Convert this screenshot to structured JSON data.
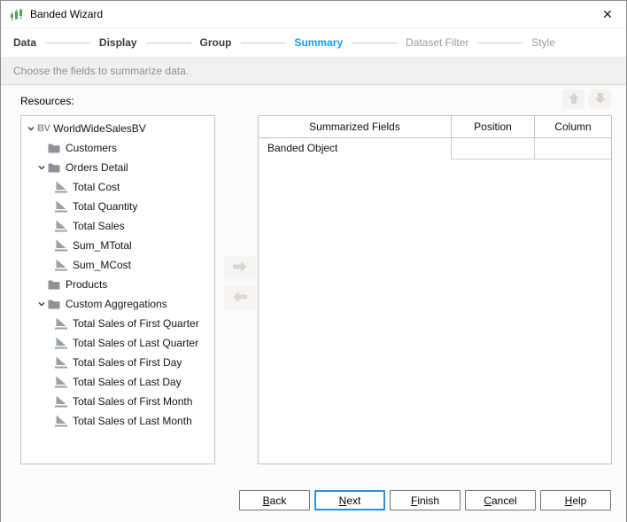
{
  "window": {
    "title": "Banded Wizard",
    "close_glyph": "✕"
  },
  "steps": {
    "items": [
      {
        "label": "Data",
        "state": "visited"
      },
      {
        "label": "Display",
        "state": "visited"
      },
      {
        "label": "Group",
        "state": "visited"
      },
      {
        "label": "Summary",
        "state": "current"
      },
      {
        "label": "Dataset Filter",
        "state": "upcoming"
      },
      {
        "label": "Style",
        "state": "upcoming"
      }
    ]
  },
  "subtitle": "Choose the fields to summarize data.",
  "resources_label": "Resources:",
  "tree": {
    "items": [
      {
        "level": 0,
        "icon": "bv",
        "expanded": true,
        "label": "WorldWideSalesBV"
      },
      {
        "level": 1,
        "icon": "folder",
        "expanded": false,
        "label": "Customers"
      },
      {
        "level": 1,
        "icon": "folder",
        "expanded": true,
        "label": "Orders Detail"
      },
      {
        "level": 2,
        "icon": "summary",
        "label": "Total Cost"
      },
      {
        "level": 2,
        "icon": "summary",
        "label": "Total Quantity"
      },
      {
        "level": 2,
        "icon": "summary",
        "label": "Total Sales"
      },
      {
        "level": 2,
        "icon": "summary",
        "label": "Sum_MTotal"
      },
      {
        "level": 2,
        "icon": "summary",
        "label": "Sum_MCost"
      },
      {
        "level": 1,
        "icon": "folder",
        "expanded": false,
        "label": "Products"
      },
      {
        "level": 1,
        "icon": "folder",
        "expanded": true,
        "label": "Custom Aggregations"
      },
      {
        "level": 2,
        "icon": "summary",
        "label": "Total Sales of First Quarter"
      },
      {
        "level": 2,
        "icon": "summary",
        "label": "Total Sales of Last Quarter"
      },
      {
        "level": 2,
        "icon": "summary",
        "label": "Total Sales of First Day"
      },
      {
        "level": 2,
        "icon": "summary",
        "label": "Total Sales of Last Day"
      },
      {
        "level": 2,
        "icon": "summary",
        "label": "Total Sales of First Month"
      },
      {
        "level": 2,
        "icon": "summary",
        "label": "Total Sales of Last Month"
      }
    ]
  },
  "table": {
    "headers": [
      "Summarized Fields",
      "Position",
      "Column"
    ],
    "rows": [
      {
        "summarized_field": "Banded Object",
        "position": "",
        "column": ""
      }
    ]
  },
  "footer": {
    "buttons": [
      {
        "label": "Back",
        "mnemonic": "B",
        "default": false
      },
      {
        "label": "Next",
        "mnemonic": "N",
        "default": true
      },
      {
        "label": "Finish",
        "mnemonic": "F",
        "default": false
      },
      {
        "label": "Cancel",
        "mnemonic": "C",
        "default": false
      },
      {
        "label": "Help",
        "mnemonic": "H",
        "default": false
      }
    ]
  },
  "colors": {
    "accent_blue": "#189af2",
    "app_icon_green": "#56a352",
    "disabled_arrow_gray": "#d7d3ce"
  }
}
